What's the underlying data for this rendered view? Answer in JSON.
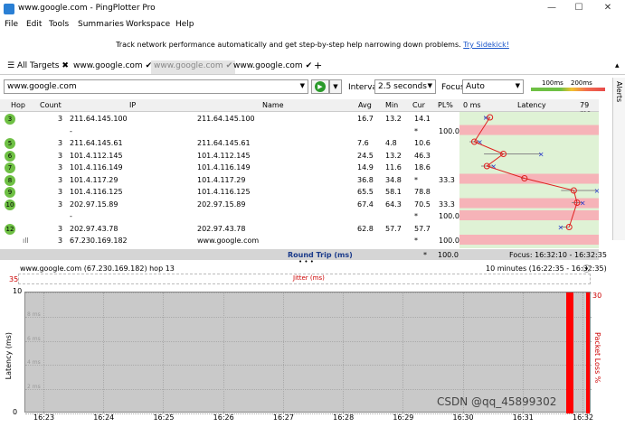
{
  "window": {
    "title": "www.google.com - PingPlotter Pro",
    "min": "—",
    "max": "☐",
    "close": "✕"
  },
  "menu": [
    "File",
    "Edit",
    "Tools",
    "Summaries",
    "Workspace",
    "Help"
  ],
  "banner": {
    "text": "Track network performance automatically and get step-by-step help narrowing down problems.",
    "link": "Try Sidekick!"
  },
  "tabs": [
    {
      "label": "All Targets",
      "mark": "✖"
    },
    {
      "label": "www.google.com",
      "mark": "✔"
    },
    {
      "label": "www.google.com",
      "mark": "✔"
    },
    {
      "label": "www.google.com",
      "mark": "✔"
    },
    {
      "label": "+",
      "mark": ""
    }
  ],
  "tabs_more": "▴",
  "toolbar": {
    "target": "www.google.com",
    "interval_label": "Interval",
    "interval_value": "2.5 seconds",
    "focus_label": "Focus",
    "focus_value": "Auto",
    "scale_100": "100ms",
    "scale_200": "200ms",
    "alerts": "Alerts"
  },
  "table": {
    "headers": [
      "Hop",
      "Count",
      "IP",
      "Name",
      "Avg",
      "Min",
      "Cur",
      "PL%",
      "0 ms",
      "Latency",
      "79 ms"
    ],
    "rows": [
      {
        "hop": "3",
        "count": "3",
        "ip": "211.64.145.100",
        "name": "211.64.145.100",
        "avg": "16.7",
        "min": "13.2",
        "cur": "14.1",
        "pl": ""
      },
      {
        "hop": "",
        "count": "",
        "ip": "-",
        "name": "",
        "avg": "",
        "min": "",
        "cur": "*",
        "pl": "100.0"
      },
      {
        "hop": "5",
        "count": "3",
        "ip": "211.64.145.61",
        "name": "211.64.145.61",
        "avg": "7.6",
        "min": "4.8",
        "cur": "10.6",
        "pl": ""
      },
      {
        "hop": "6",
        "count": "3",
        "ip": "101.4.112.145",
        "name": "101.4.112.145",
        "avg": "24.5",
        "min": "13.2",
        "cur": "46.3",
        "pl": ""
      },
      {
        "hop": "7",
        "count": "3",
        "ip": "101.4.116.149",
        "name": "101.4.116.149",
        "avg": "14.9",
        "min": "11.6",
        "cur": "18.6",
        "pl": ""
      },
      {
        "hop": "8",
        "count": "3",
        "ip": "101.4.117.29",
        "name": "101.4.117.29",
        "avg": "36.8",
        "min": "34.8",
        "cur": "*",
        "pl": "33.3"
      },
      {
        "hop": "9",
        "count": "3",
        "ip": "101.4.116.125",
        "name": "101.4.116.125",
        "avg": "65.5",
        "min": "58.1",
        "cur": "78.8",
        "pl": ""
      },
      {
        "hop": "10",
        "count": "3",
        "ip": "202.97.15.89",
        "name": "202.97.15.89",
        "avg": "67.4",
        "min": "64.3",
        "cur": "70.5",
        "pl": "33.3"
      },
      {
        "hop": "",
        "count": "",
        "ip": "-",
        "name": "",
        "avg": "",
        "min": "",
        "cur": "*",
        "pl": "100.0"
      },
      {
        "hop": "12",
        "count": "3",
        "ip": "202.97.43.78",
        "name": "202.97.43.78",
        "avg": "62.8",
        "min": "57.7",
        "cur": "57.7",
        "pl": ""
      },
      {
        "hop": "",
        "count": "3",
        "ip": "67.230.169.182",
        "name": "www.google.com",
        "avg": "",
        "min": "",
        "cur": "*",
        "pl": "100.0"
      }
    ],
    "round_trip": {
      "label": "Round Trip (ms)",
      "cur": "*",
      "pl": "100.0",
      "focus": "Focus: 16:32:10 - 16:32:35"
    },
    "ellipsis": "• • •"
  },
  "lower": {
    "title": "www.google.com (67.230.169.182) hop 13",
    "range": "10 minutes (16:22:35 - 16:32:35)",
    "jitter_label": "Jitter (ms)",
    "jitter_max": "35",
    "y_axis_label": "Latency (ms)",
    "y_ticks": [
      "10",
      "8 ms",
      "6 ms",
      "4 ms",
      "2 ms",
      "0"
    ],
    "x_ticks": [
      "16:23",
      "16:24",
      "16:25",
      "16:26",
      "16:27",
      "16:28",
      "16:29",
      "16:30",
      "16:31",
      "16:32"
    ],
    "right_axis_label": "Packet Loss %",
    "right_max": "30",
    "watermark": "CSDN @qq_45899302"
  },
  "colors": {
    "accent": "#6ec044",
    "loss": "#ff0000",
    "band": "#f6b3b8",
    "graph_bg": "#dff2d5"
  }
}
